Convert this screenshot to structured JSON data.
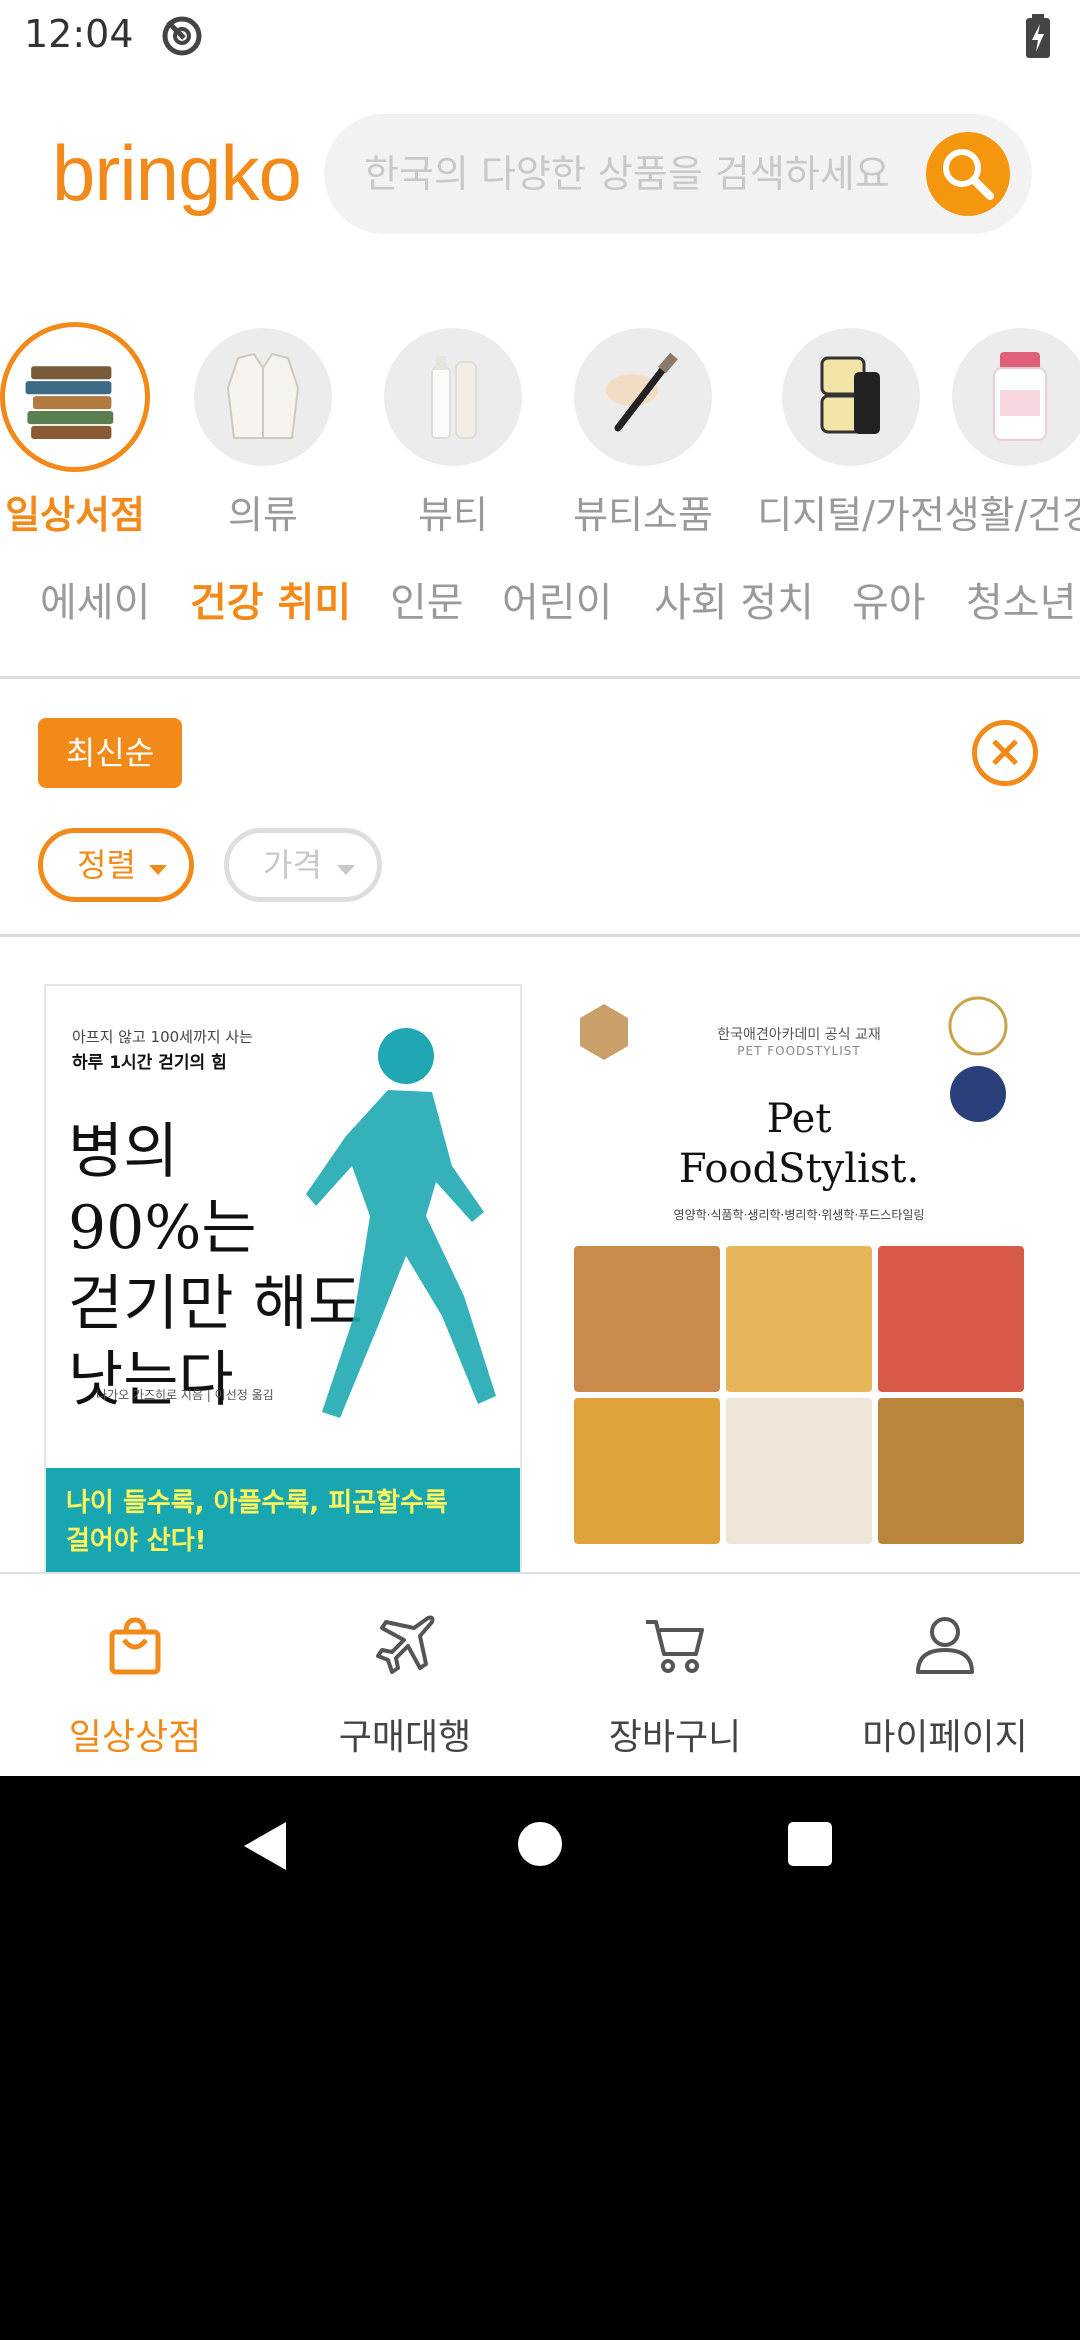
{
  "status_bar": {
    "time": "12:04"
  },
  "header": {
    "logo": "bringko",
    "search_placeholder": "한국의 다양한 상품을 검색하세요"
  },
  "categories": [
    {
      "label": "일상서점",
      "active": true
    },
    {
      "label": "의류",
      "active": false
    },
    {
      "label": "뷰티",
      "active": false
    },
    {
      "label": "뷰티소품",
      "active": false
    },
    {
      "label": "디지털/가전",
      "active": false
    },
    {
      "label": "생활/건강",
      "active": false
    }
  ],
  "subcategories": [
    {
      "label": "에세이",
      "active": false
    },
    {
      "label": "건강 취미",
      "active": true
    },
    {
      "label": "인문",
      "active": false
    },
    {
      "label": "어린이",
      "active": false
    },
    {
      "label": "사회 정치",
      "active": false
    },
    {
      "label": "유아",
      "active": false
    },
    {
      "label": "청소년",
      "active": false
    }
  ],
  "filters": {
    "applied_chip": "최신순",
    "clear_icon": "×",
    "dropdowns": [
      {
        "label": "정렬",
        "active": true
      },
      {
        "label": "가격",
        "active": false
      }
    ]
  },
  "products": [
    {
      "cover_kicker": "아프지 않고 100세까지 사는",
      "cover_kicker_bold": "하루 1시간 걷기의 힘",
      "cover_title_lines": [
        "병의",
        "90%는",
        "걷기만 해도",
        "낫는다"
      ],
      "cover_author": "나가오 가즈히로 지음 | 이선정 옮김",
      "cover_band_lines": [
        "나이 들수록, 아플수록, 피곤할수록",
        "걸어야 산다!"
      ]
    },
    {
      "cover_sub1": "한국애견아카데미 공식 교재",
      "cover_sub2": "PET FOODSTYLIST",
      "cover_title_lines": [
        "Pet",
        "FoodStylist."
      ],
      "cover_tagline": "영양학·식품학·생리학·병리학·위생학·푸드스타일링"
    }
  ],
  "bottom_nav": [
    {
      "label": "일상상점",
      "icon": "shopping-bag-icon",
      "active": true
    },
    {
      "label": "구매대행",
      "icon": "airplane-icon",
      "active": false
    },
    {
      "label": "장바구니",
      "icon": "cart-icon",
      "active": false
    },
    {
      "label": "마이페이지",
      "icon": "user-icon",
      "active": false
    }
  ],
  "colors": {
    "accent": "#f28a1a",
    "search_button": "#f5960f",
    "band": "#18a7b0"
  }
}
